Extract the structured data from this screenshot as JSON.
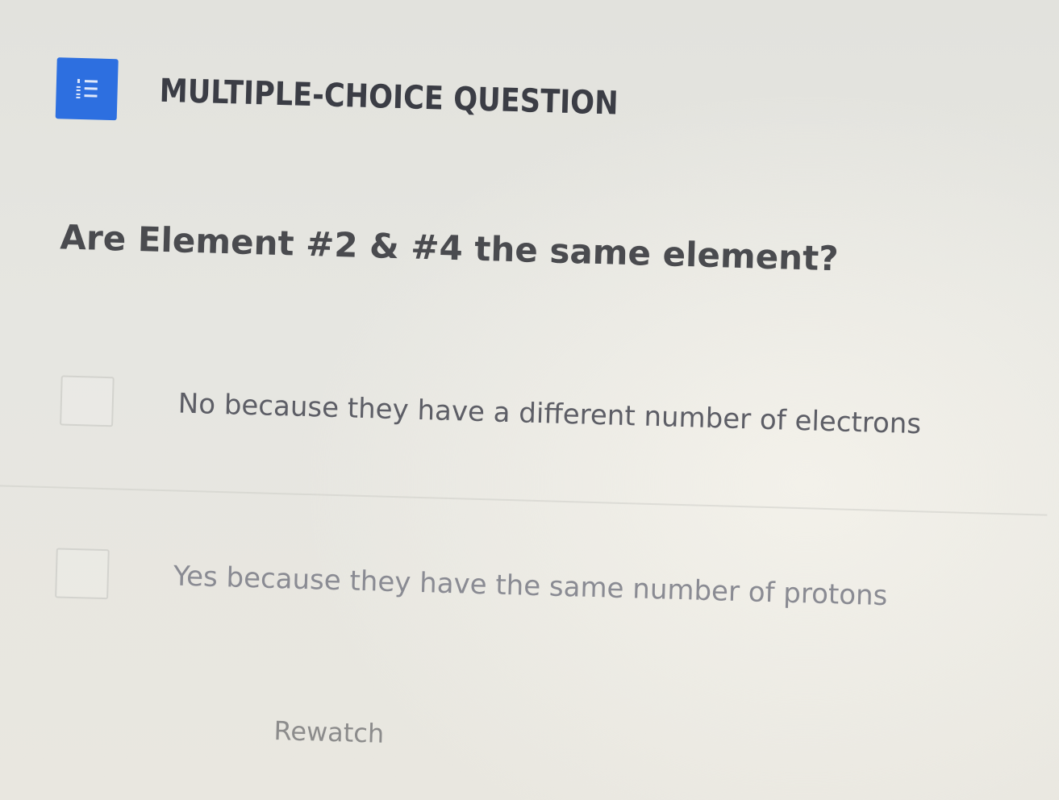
{
  "header": {
    "icon": "numbered-list-icon",
    "type_label": "MULTIPLE-CHOICE QUESTION"
  },
  "question": {
    "text": "Are Element #2 & #4 the same element?"
  },
  "options": [
    {
      "text": "No because they have a different number of electrons",
      "checked": false
    },
    {
      "text": "Yes because they have the same number of protons",
      "checked": false
    }
  ],
  "actions": {
    "rewatch_label": "Rewatch"
  },
  "colors": {
    "accent": "#2d6fe0"
  }
}
